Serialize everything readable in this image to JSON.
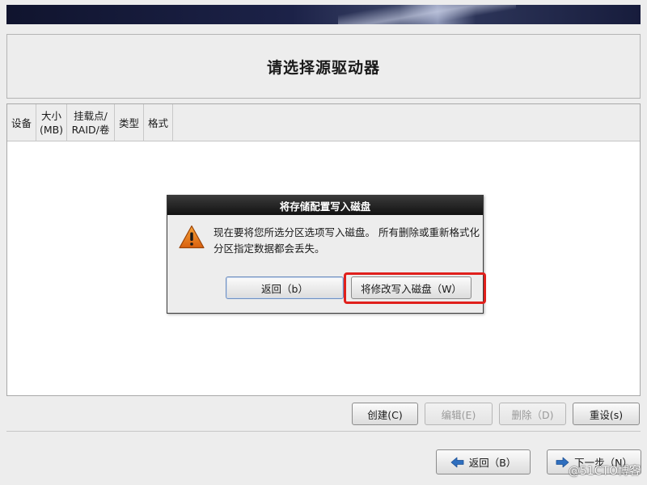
{
  "header": {
    "title": "请选择源驱动器"
  },
  "table": {
    "columns": [
      "设备",
      "大小\n(MB)",
      "挂载点/\nRAID/卷",
      "类型",
      "格式"
    ]
  },
  "dialog": {
    "title": "将存储配置写入磁盘",
    "icon": "warning-icon",
    "message": "现在要将您所选分区选项写入磁盘。 所有删除或重新格式化分区指定数据都会丢失。",
    "buttons": {
      "back": "返回（b）",
      "write": "将修改写入磁盘（W）"
    }
  },
  "actions": {
    "create": "创建(C)",
    "edit": "编辑(E)",
    "delete": "删除（D)",
    "reset": "重设(s)"
  },
  "nav": {
    "back": "返回（B）",
    "next": "下一步（N）"
  },
  "watermark": "@51CTO博客",
  "colors": {
    "highlight": "#e0201c",
    "nav_arrow": "#2f6fbf",
    "warning": "#e8731a"
  }
}
